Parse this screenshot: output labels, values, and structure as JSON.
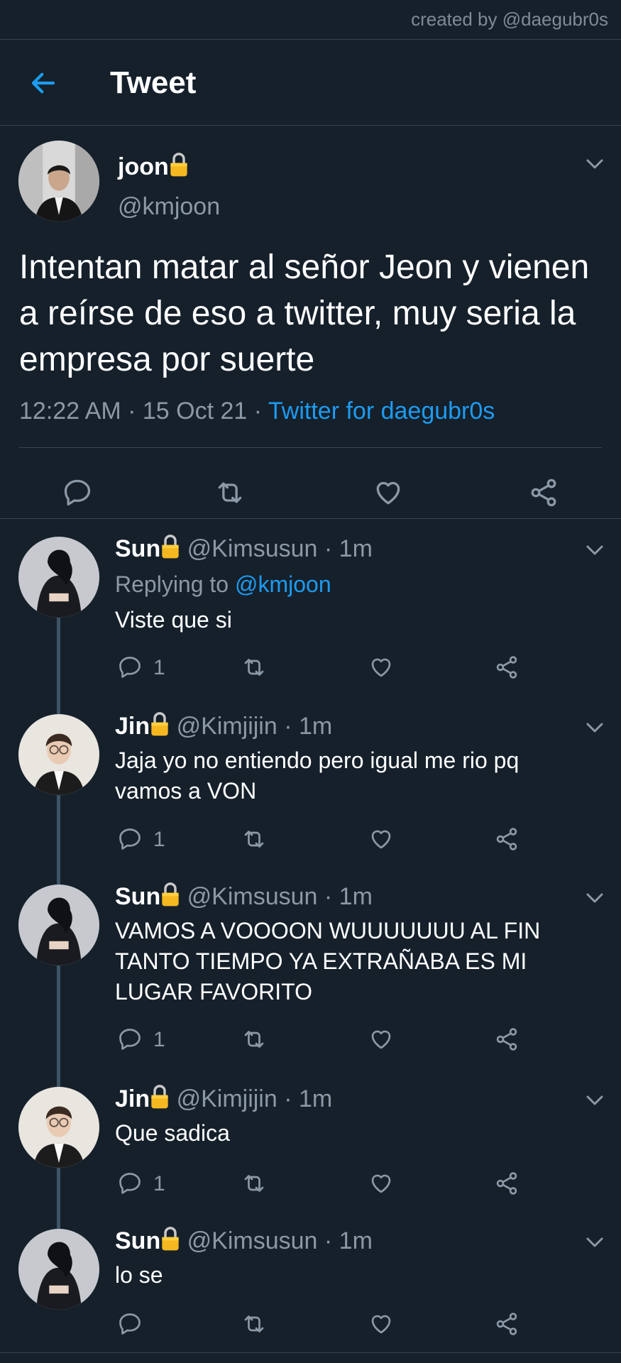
{
  "credit": "created by @daegubr0s",
  "header": {
    "title": "Tweet"
  },
  "tweet": {
    "name": "joon",
    "handle": "@kmjoon",
    "text": "Intentan matar al señor Jeon y vienen a reírse de eso a twitter, muy seria la empresa por suerte",
    "time": "12:22 AM · 15 Oct 21 · ",
    "source": "Twitter for daegubr0s"
  },
  "replies": [
    {
      "name": "Sun",
      "handle": "@Kimsusun · 1m",
      "replying_label": "Replying to ",
      "replying_to": "@kmjoon",
      "text": "Viste que si",
      "reply_count": "1"
    },
    {
      "name": "Jin",
      "handle": "@Kimjijin · 1m",
      "text": "Jaja yo no entiendo pero igual me rio pq vamos a VON",
      "reply_count": "1"
    },
    {
      "name": "Sun",
      "handle": "@Kimsusun · 1m",
      "text": "VAMOS A VOOOON WUUUUUUU AL FIN TANTO TIEMPO YA EXTRAÑABA ES MI LUGAR FAVORITO",
      "reply_count": "1"
    },
    {
      "name": "Jin",
      "handle": "@Kimjijin · 1m",
      "text": "Que sadica",
      "reply_count": "1"
    },
    {
      "name": "Sun",
      "handle": "@Kimsusun · 1m",
      "text": "lo se",
      "reply_count": ""
    }
  ],
  "colors": {
    "background": "#15202b",
    "accent": "#1d9bf0",
    "muted": "#8b98a5",
    "divider": "#38444d"
  }
}
